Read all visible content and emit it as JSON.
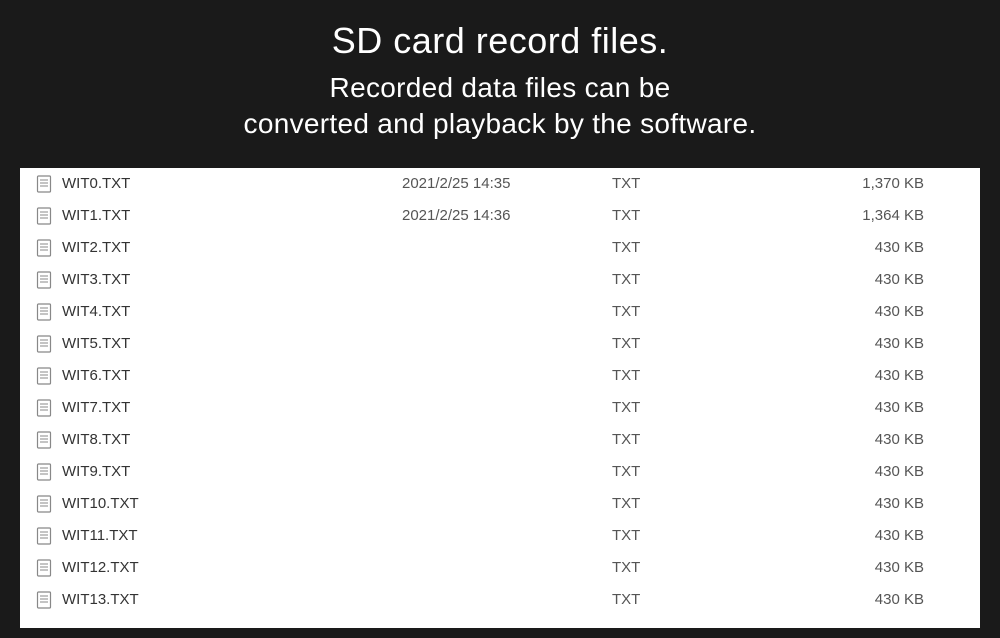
{
  "header": {
    "title": "SD card record files.",
    "subtitle_line1": "Recorded data files can be",
    "subtitle_line2": "converted and playback by the software."
  },
  "files": [
    {
      "name": "WIT0.TXT",
      "date": "2021/2/25 14:35",
      "type": "TXT",
      "size": "1,370 KB"
    },
    {
      "name": "WIT1.TXT",
      "date": "2021/2/25 14:36",
      "type": "TXT",
      "size": "1,364 KB"
    },
    {
      "name": "WIT2.TXT",
      "date": "",
      "type": "TXT",
      "size": "430 KB"
    },
    {
      "name": "WIT3.TXT",
      "date": "",
      "type": "TXT",
      "size": "430 KB"
    },
    {
      "name": "WIT4.TXT",
      "date": "",
      "type": "TXT",
      "size": "430 KB"
    },
    {
      "name": "WIT5.TXT",
      "date": "",
      "type": "TXT",
      "size": "430 KB"
    },
    {
      "name": "WIT6.TXT",
      "date": "",
      "type": "TXT",
      "size": "430 KB"
    },
    {
      "name": "WIT7.TXT",
      "date": "",
      "type": "TXT",
      "size": "430 KB"
    },
    {
      "name": "WIT8.TXT",
      "date": "",
      "type": "TXT",
      "size": "430 KB"
    },
    {
      "name": "WIT9.TXT",
      "date": "",
      "type": "TXT",
      "size": "430 KB"
    },
    {
      "name": "WIT10.TXT",
      "date": "",
      "type": "TXT",
      "size": "430 KB"
    },
    {
      "name": "WIT11.TXT",
      "date": "",
      "type": "TXT",
      "size": "430 KB"
    },
    {
      "name": "WIT12.TXT",
      "date": "",
      "type": "TXT",
      "size": "430 KB"
    },
    {
      "name": "WIT13.TXT",
      "date": "",
      "type": "TXT",
      "size": "430 KB"
    }
  ]
}
